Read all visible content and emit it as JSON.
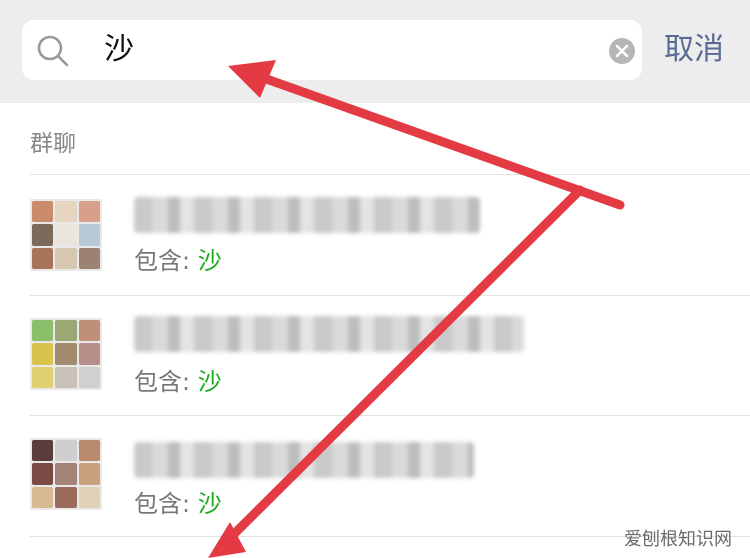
{
  "search": {
    "query": "沙",
    "cancel_label": "取消"
  },
  "section": {
    "label": "群聊"
  },
  "results": [
    {
      "contains_label": "包含:",
      "match": "沙"
    },
    {
      "contains_label": "包含:",
      "match": "沙"
    },
    {
      "contains_label": "包含:",
      "match": "沙"
    }
  ],
  "watermark": "爱刨根知识网",
  "colors": {
    "accent": "#576b95",
    "highlight": "#1aad19",
    "annotation": "#e33a44"
  }
}
